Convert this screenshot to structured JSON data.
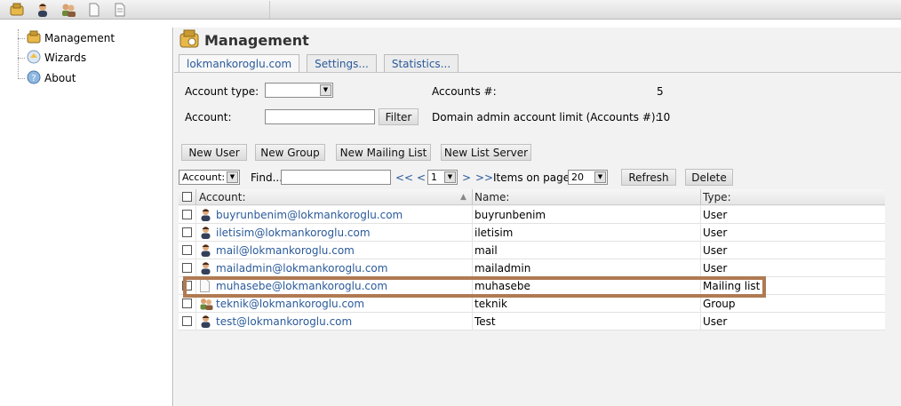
{
  "toolbar": {
    "icons": [
      "management-icon",
      "user-icon",
      "group-icon",
      "document-icon",
      "document-list-icon"
    ]
  },
  "sidebar": {
    "items": [
      {
        "label": "Management",
        "icon": "management-icon"
      },
      {
        "label": "Wizards",
        "icon": "wizard-icon"
      },
      {
        "label": "About",
        "icon": "help-icon"
      }
    ]
  },
  "main": {
    "title": "Management",
    "tabs": [
      {
        "label": "lokmankoroglu.com"
      },
      {
        "label": "Settings..."
      },
      {
        "label": "Statistics..."
      }
    ],
    "form": {
      "account_type_label": "Account type:",
      "account_type_value": "",
      "account_label": "Account:",
      "account_value": "",
      "filter_label": "Filter",
      "accounts_count_label": "Accounts #:",
      "accounts_count_value": "5",
      "limit_label": "Domain admin account limit (Accounts #):",
      "limit_value": "10"
    },
    "actions": {
      "new_user": "New User",
      "new_group": "New Group",
      "new_mailing_list": "New Mailing List",
      "new_list_server": "New List Server"
    },
    "pager": {
      "field_select": "Account:",
      "find_label": "Find...",
      "find_value": "",
      "first": "<<",
      "prev": "<",
      "page": "1",
      "next": ">",
      "last": ">>",
      "items_label": "Items on page:",
      "items_value": "20",
      "refresh": "Refresh",
      "delete": "Delete"
    },
    "grid": {
      "headers": {
        "account": "Account:",
        "name": "Name:",
        "type": "Type:"
      },
      "rows": [
        {
          "account": "buyrunbenim@lokmankoroglu.com",
          "name": "buyrunbenim",
          "type": "User",
          "icon": "user-icon"
        },
        {
          "account": "iletisim@lokmankoroglu.com",
          "name": "iletisim",
          "type": "User",
          "icon": "user-icon"
        },
        {
          "account": "mail@lokmankoroglu.com",
          "name": "mail",
          "type": "User",
          "icon": "user-icon"
        },
        {
          "account": "mailadmin@lokmankoroglu.com",
          "name": "mailadmin",
          "type": "User",
          "icon": "user-icon"
        },
        {
          "account": "muhasebe@lokmankoroglu.com",
          "name": "muhasebe",
          "type": "Mailing list",
          "icon": "mailing-list-icon"
        },
        {
          "account": "teknik@lokmankoroglu.com",
          "name": "teknik",
          "type": "Group",
          "icon": "group-icon"
        },
        {
          "account": "test@lokmankoroglu.com",
          "name": "Test",
          "type": "User",
          "icon": "user-icon"
        }
      ]
    },
    "highlight_color": "#b07a52",
    "link_color": "#2a5a9a"
  }
}
